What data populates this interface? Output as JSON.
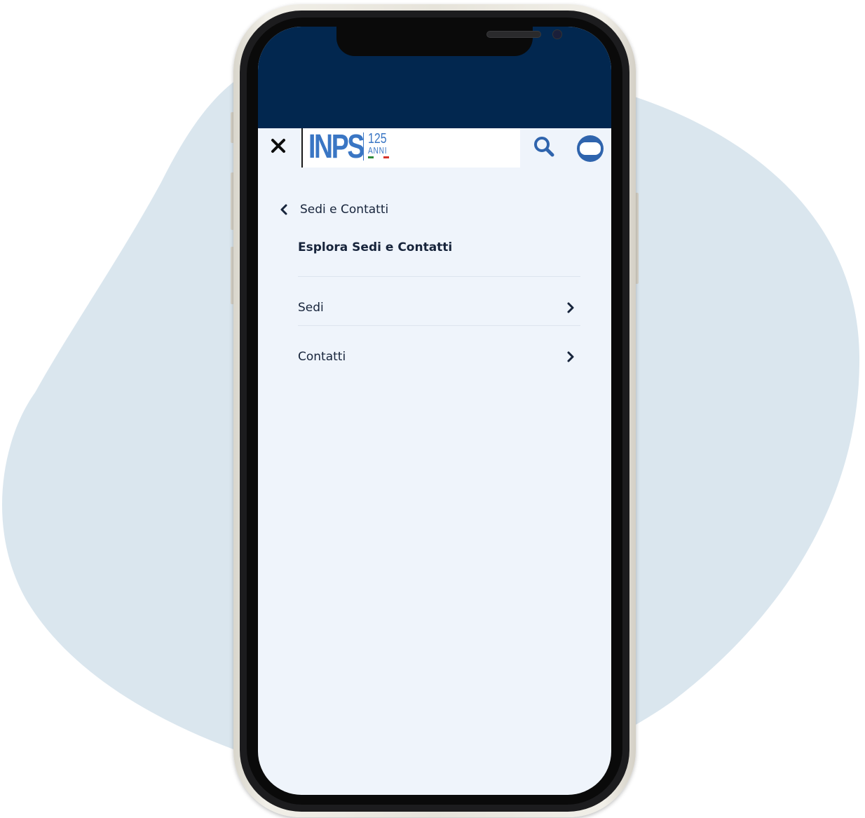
{
  "header": {
    "close_icon": "close-icon",
    "logo_text": "INPS",
    "logo_number": "125",
    "logo_sub": "ANNI",
    "search_icon": "search-icon",
    "user_icon": "user-icon"
  },
  "menu": {
    "back_label": "Sedi e Contatti",
    "explore_label": "Esplora Sedi e Contatti",
    "items": [
      {
        "label": "Sedi"
      },
      {
        "label": "Contatti"
      }
    ]
  },
  "colors": {
    "brand_dark": "#02274f",
    "brand_blue": "#3a76c4",
    "background": "#eff4fb",
    "text": "#17243b",
    "blob": "#dae6ee"
  }
}
